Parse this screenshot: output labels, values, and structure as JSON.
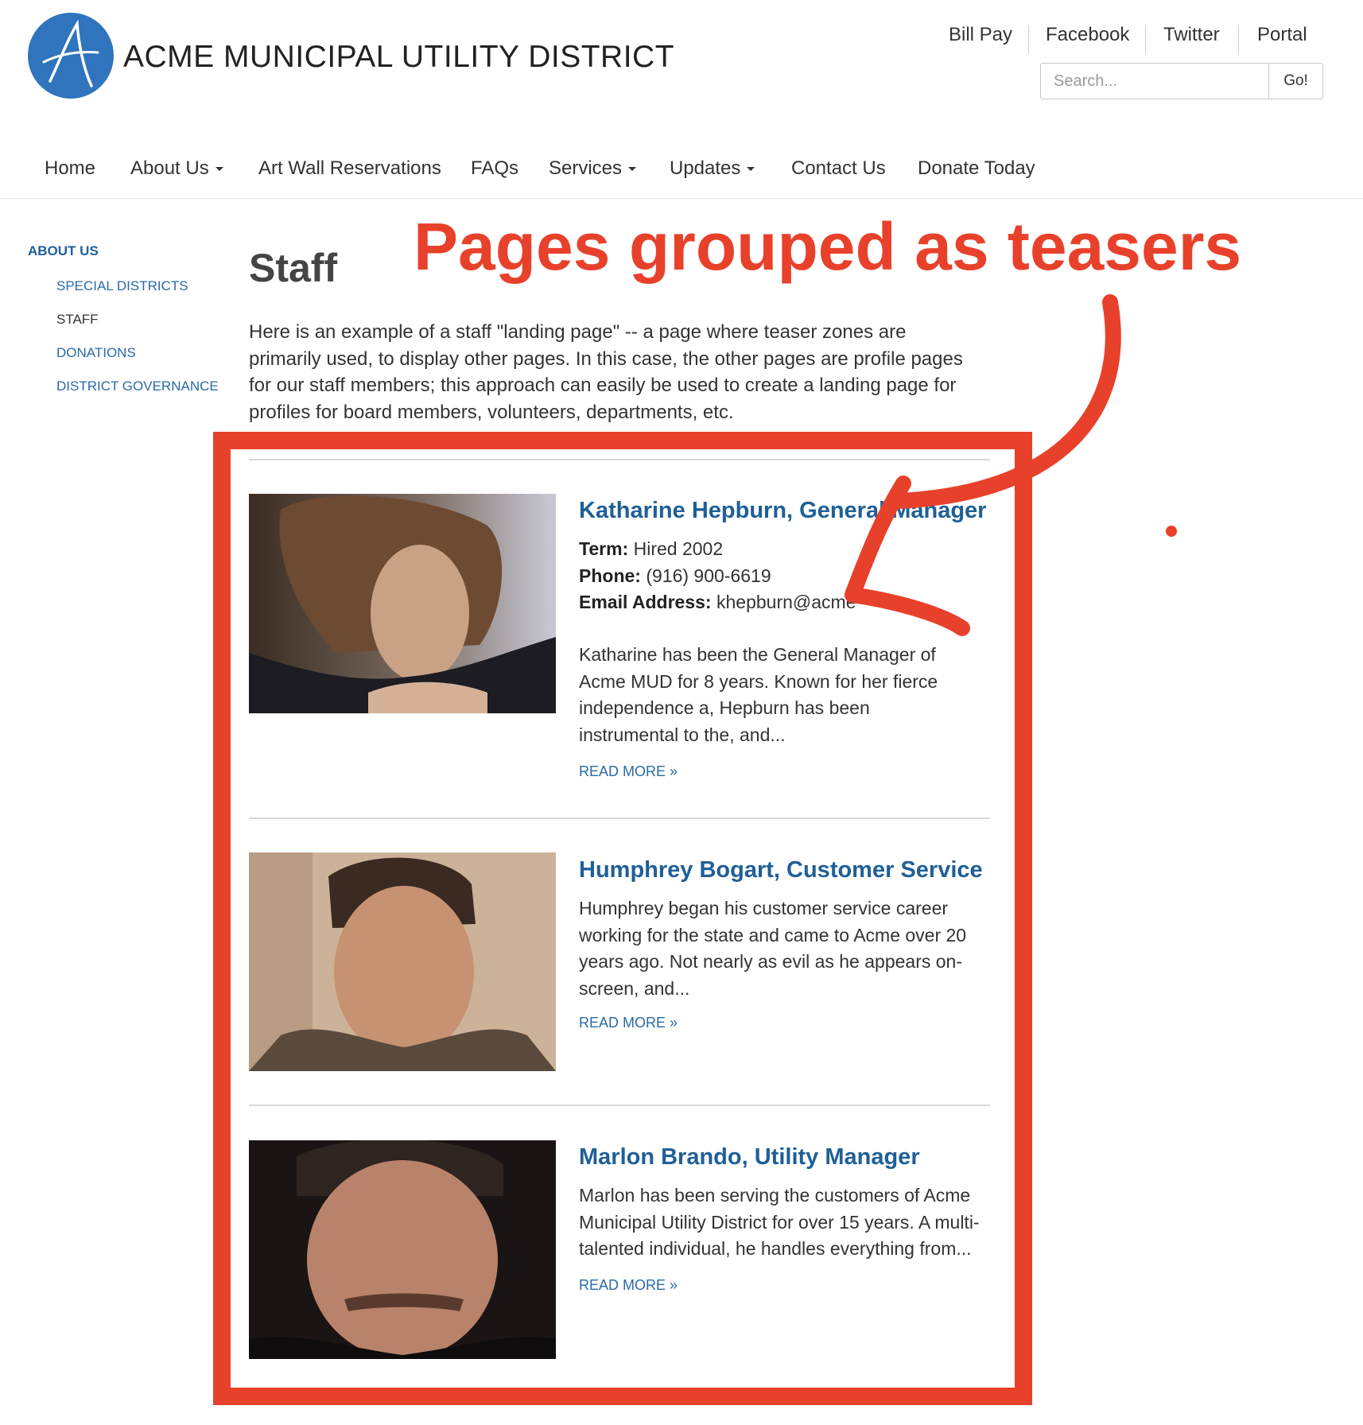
{
  "header": {
    "logo_alt": "A",
    "site_title": "ACME MUNICIPAL UTILITY DISTRICT",
    "util_links": [
      "Bill Pay",
      "Facebook",
      "Twitter",
      "Portal"
    ],
    "search": {
      "placeholder": "Search...",
      "button": "Go!"
    }
  },
  "nav": {
    "items": [
      {
        "label": "Home",
        "dropdown": false
      },
      {
        "label": "About Us",
        "dropdown": true
      },
      {
        "label": "Art Wall Reservations",
        "dropdown": false
      },
      {
        "label": "FAQs",
        "dropdown": false
      },
      {
        "label": "Services",
        "dropdown": true
      },
      {
        "label": "Updates",
        "dropdown": true
      },
      {
        "label": "Contact Us",
        "dropdown": false
      },
      {
        "label": "Donate Today",
        "dropdown": false
      }
    ]
  },
  "sidebar": {
    "heading": "ABOUT US",
    "items": [
      {
        "label": "SPECIAL DISTRICTS",
        "current": false
      },
      {
        "label": "STAFF",
        "current": true
      },
      {
        "label": "DONATIONS",
        "current": false
      },
      {
        "label": "DISTRICT GOVERNANCE",
        "current": false
      }
    ]
  },
  "main": {
    "title": "Staff",
    "intro": "Here is an example of a staff \"landing page\" -- a page where teaser zones are primarily used, to display other pages. In this case, the other pages are profile pages for our staff members; this approach can easily be used to create a landing page for profiles for board members, volunteers, departments, etc.",
    "teasers": [
      {
        "title": "Katharine Hepburn, General Manager",
        "fields": [
          {
            "label": "Term:",
            "value": "Hired 2002"
          },
          {
            "label": "Phone:",
            "value": "(916) 900-6619"
          },
          {
            "label": "Email Address:",
            "value": "khepburn@acme"
          }
        ],
        "summary": "Katharine has been the General Manager of Acme MUD for 8 years. Known for her fierce independence a, Hepburn has been instrumental to the, and...",
        "read_more": "READ MORE »"
      },
      {
        "title": "Humphrey Bogart, Customer Service",
        "fields": [],
        "summary": "Humphrey began his customer service career working for the state and came to Acme over 20 years ago. Not nearly as evil as he appears on-screen, and...",
        "read_more": "READ MORE »"
      },
      {
        "title": "Marlon Brando, Utility Manager",
        "fields": [],
        "summary": "Marlon has been serving the customers of Acme Municipal Utility District for over 15 years. A multi-talented individual, he handles everything from...",
        "read_more": "READ MORE »"
      }
    ]
  },
  "annotation": {
    "text": "Pages grouped as teasers",
    "color": "#e8412b"
  },
  "colors": {
    "brand_blue": "#2f74bd",
    "link_blue": "#1f5f97",
    "annotation_red": "#e8412b"
  }
}
